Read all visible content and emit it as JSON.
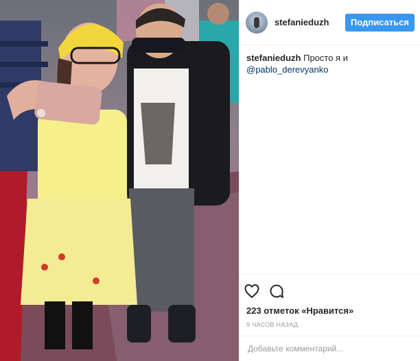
{
  "post": {
    "author": "stefanieduzh",
    "follow_label": "Подписаться",
    "caption": {
      "username": "stefanieduzh",
      "text": "Просто я и",
      "mention": "@pablo_derevyanko"
    },
    "likes_text": "223 отметок «Нравится»",
    "time_ago": "9 часов назад",
    "comment_placeholder": "Добавьте комментарий...",
    "icons": [
      "heart-icon",
      "comment-icon"
    ],
    "colors": {
      "accent": "#3897f0",
      "mention": "#003569",
      "muted": "#999999"
    }
  }
}
